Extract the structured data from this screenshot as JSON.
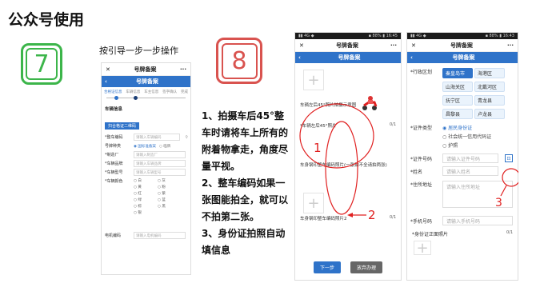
{
  "slide_title": "公众号使用",
  "step7": {
    "number": "7",
    "caption": "按引导一步一步操作"
  },
  "step8": {
    "number": "8"
  },
  "instructions": [
    "1、拍摄车后45°整车时请将车上所有的附着物拿走，角度尽量平视。",
    "2、整车编码如果一张图能拍全，就可以不拍第二张。",
    "3、身份证拍照自动填信息"
  ],
  "phone1": {
    "header_title": "号牌备案",
    "nav_title": "号牌备案",
    "steps": [
      "合格证信息",
      "车辆信息",
      "车主信息",
      "签字确认",
      "完成"
    ],
    "section_title": "车辆信息",
    "scan_button": "扫合格证二维码",
    "fields": [
      {
        "label": "*整车编码",
        "placeholder": "请输入车辆编码"
      },
      {
        "label": "号牌种类",
        "placeholder": ""
      },
      {
        "label": "*制造厂",
        "placeholder": "请输入制造厂"
      },
      {
        "label": "*车辆品牌",
        "placeholder": "请输入车辆品牌"
      },
      {
        "label": "*车辆型号",
        "placeholder": "请输入车辆型号"
      }
    ],
    "plate_options": [
      "◉ 国标准备案",
      "○ 临牌"
    ],
    "color_label": "*车辆颜色",
    "colors": [
      "白",
      "灰",
      "黄",
      "粉",
      "红",
      "紫",
      "绿",
      "蓝",
      "棕",
      "黑",
      "银"
    ],
    "motor_label": "电机编码",
    "motor_placeholder": "请输入电机编码"
  },
  "phone2": {
    "status_left": "▮▮ 4G ◆",
    "status_right": "▪ 88% ▮ 16:45",
    "header_title": "号牌备案",
    "nav_title": "号牌备案",
    "photo_hint": "车辆左后45°照片拍摄示意图",
    "field1_label": "*车辆左后45°照片",
    "field1_count": "0/1",
    "field2_label": "车身钢印整车编码照片(一张拍不全请拍两张)",
    "field3_label": "车身钢印整车编码照片2",
    "field3_count": "0/1",
    "next_button": "下一步",
    "abandon_button": "放弃办理",
    "annotations": [
      "1",
      "2"
    ]
  },
  "phone3": {
    "status_left": "▮▮ 4G ◆",
    "status_right": "▪ 88% ▮ 16:43",
    "header_title": "号牌备案",
    "nav_title": "号牌备案",
    "district_label": "*行政区划",
    "districts": [
      [
        "秦皇岛市",
        "海港区"
      ],
      [
        "山海关区",
        "北戴河区"
      ],
      [
        "抚宁区",
        "青龙县"
      ],
      [
        "昌黎县",
        "卢龙县"
      ]
    ],
    "cert_type_label": "*证件类型",
    "cert_types": [
      "◉ 居民身份证",
      "○ 社会统一信用代码证",
      "○ 护照"
    ],
    "cert_no_label": "*证件号码",
    "cert_no_placeholder": "请输入证件号码",
    "name_label": "*姓名",
    "name_placeholder": "请输入姓名",
    "address_label": "*住所地址",
    "address_placeholder": "请输入住所地址",
    "phone_label": "*手机号码",
    "phone_placeholder": "请输入手机号码",
    "id_photo_label": "*身份证正面照片",
    "id_photo_count": "0/1",
    "annotation": "3"
  },
  "colors": {
    "accent": "#2f73c9",
    "green": "#3cb54a",
    "red": "#e02020"
  }
}
